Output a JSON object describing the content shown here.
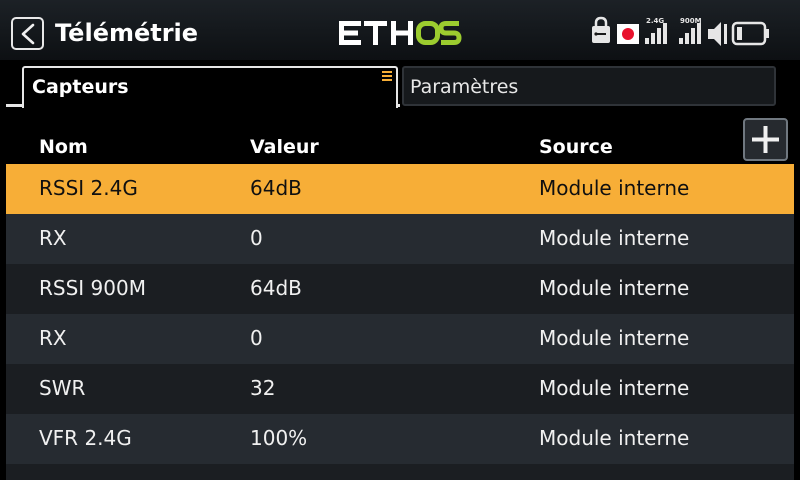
{
  "header": {
    "title": "Télémétrie",
    "logo_text": "ETHOS",
    "icons": {
      "back": "back-chevron-icon",
      "usb": "usb-lock-icon",
      "record": "record-icon",
      "signal_24": "signal-2.4g-icon",
      "signal_900": "signal-900m-icon",
      "volume": "volume-icon",
      "battery": "battery-icon"
    },
    "signal_labels": {
      "band1": "2.4G",
      "band2": "900M"
    }
  },
  "tabs": [
    {
      "label": "Capteurs",
      "active": true
    },
    {
      "label": "Paramètres",
      "active": false
    }
  ],
  "table": {
    "columns": [
      "Nom",
      "Valeur",
      "Source"
    ],
    "rows": [
      {
        "name": "RSSI 2.4G",
        "value": "64dB",
        "source": "Module interne",
        "selected": true
      },
      {
        "name": "RX",
        "value": "0",
        "source": "Module interne"
      },
      {
        "name": "RSSI 900M",
        "value": "64dB",
        "source": "Module interne"
      },
      {
        "name": "RX",
        "value": "0",
        "source": "Module interne"
      },
      {
        "name": "SWR",
        "value": "32",
        "source": "Module interne"
      },
      {
        "name": "VFR 2.4G",
        "value": "100%",
        "source": "Module interne"
      }
    ]
  },
  "colors": {
    "accent": "#f7ae37",
    "logo_green": "#9ccc2f",
    "record_red": "#e8112d"
  }
}
